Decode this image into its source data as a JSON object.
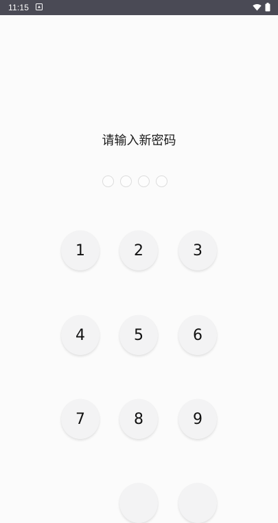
{
  "status_bar": {
    "time": "11:15",
    "icons": [
      "notification-icon",
      "wifi-icon",
      "battery-icon"
    ]
  },
  "title": "请输入新密码",
  "pin_dots": {
    "count": 4,
    "filled": 0
  },
  "keypad": {
    "keys": [
      "1",
      "2",
      "3",
      "4",
      "5",
      "6",
      "7",
      "8",
      "9",
      "",
      ""
    ]
  },
  "colors": {
    "status_bar_bg": "#4a4a55",
    "background": "#fbfbfb",
    "key_bg": "#f3f3f4",
    "text": "#1a1a1a"
  }
}
